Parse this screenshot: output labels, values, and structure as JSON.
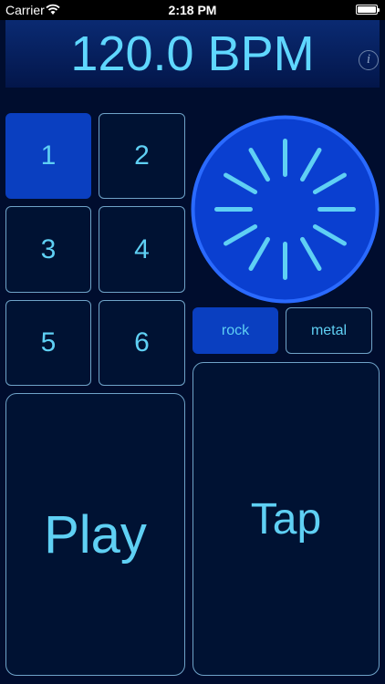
{
  "status_bar": {
    "carrier": "Carrier",
    "time": "2:18 PM"
  },
  "tempo": {
    "display": "120.0 BPM",
    "info_label": "i"
  },
  "pads": [
    {
      "label": "1",
      "selected": true
    },
    {
      "label": "2",
      "selected": false
    },
    {
      "label": "3",
      "selected": false
    },
    {
      "label": "4",
      "selected": false
    },
    {
      "label": "5",
      "selected": false
    },
    {
      "label": "6",
      "selected": false
    }
  ],
  "styles": [
    {
      "label": "rock",
      "selected": true
    },
    {
      "label": "metal",
      "selected": false
    }
  ],
  "controls": {
    "play_label": "Play",
    "tap_label": "Tap"
  },
  "colors": {
    "background": "#000d2e",
    "accent": "#5fd0f4",
    "selected": "#0a3fc0",
    "dial_fill": "#0a3fd0",
    "dial_ring": "#2a6aff"
  },
  "dial": {
    "tick_count": 12
  }
}
